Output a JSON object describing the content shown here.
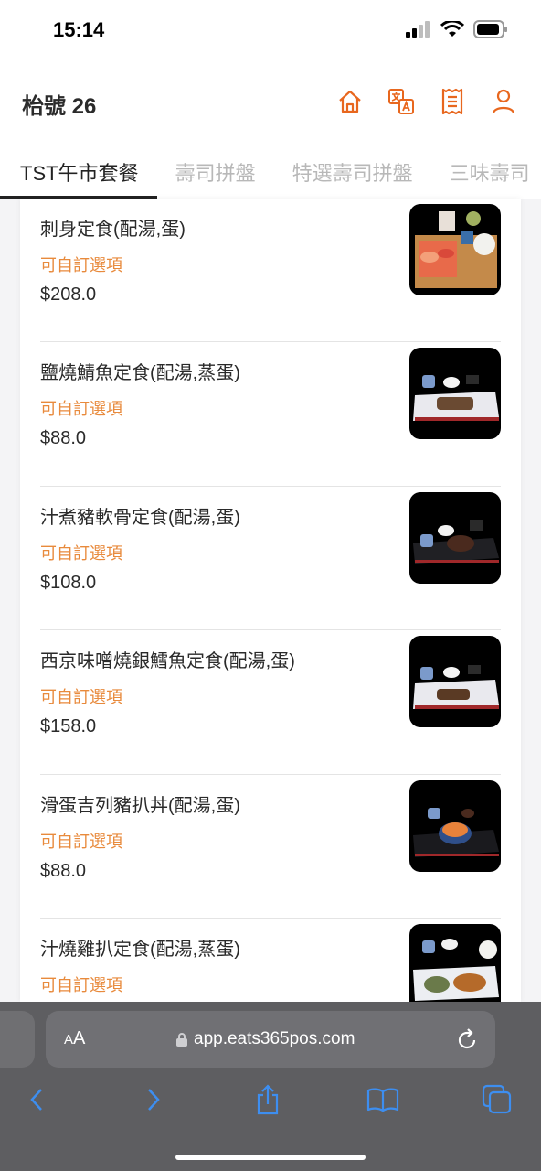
{
  "status_bar": {
    "time": "15:14"
  },
  "header": {
    "table_label": "枱號 26"
  },
  "header_icons": [
    "home-icon",
    "translate-icon",
    "order-list-icon",
    "user-icon"
  ],
  "tabs": [
    {
      "label": "TST午市套餐",
      "active": true
    },
    {
      "label": "壽司拼盤",
      "active": false
    },
    {
      "label": "特選壽司拼盤",
      "active": false
    },
    {
      "label": "三味壽司",
      "active": false
    }
  ],
  "items": [
    {
      "name": "刺身定食(配湯,蛋)",
      "option": "可自訂選項",
      "price": "$208.0"
    },
    {
      "name": "鹽燒鯖魚定食(配湯,蒸蛋)",
      "option": "可自訂選項",
      "price": "$88.0"
    },
    {
      "name": "汁煮豬軟骨定食(配湯,蛋)",
      "option": "可自訂選項",
      "price": "$108.0"
    },
    {
      "name": "西京味噌燒銀鱈魚定食(配湯,蛋)",
      "option": "可自訂選項",
      "price": "$158.0"
    },
    {
      "name": "滑蛋吉列豬扒丼(配湯,蛋)",
      "option": "可自訂選項",
      "price": "$88.0"
    },
    {
      "name": "汁燒雞扒定食(配湯,蒸蛋)",
      "option": "可自訂選項",
      "price": ""
    }
  ],
  "browser": {
    "aa_label_small": "A",
    "aa_label_large": "A",
    "url": "app.eats365pos.com"
  },
  "colors": {
    "accent": "#e8671e",
    "option_text": "#e88a3c",
    "browser_blue": "#3d8ef0"
  }
}
